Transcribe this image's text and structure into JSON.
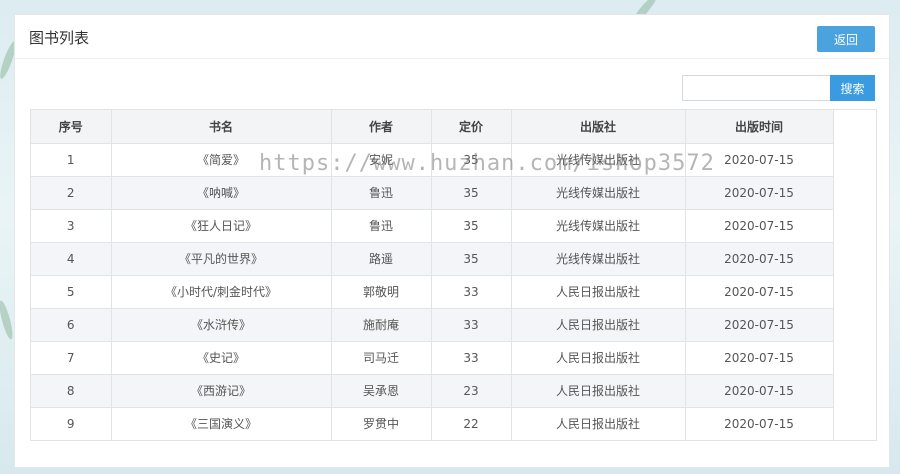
{
  "panel": {
    "title": "图书列表",
    "back_label": "返回"
  },
  "search": {
    "placeholder": "",
    "value": "",
    "button_label": "搜索"
  },
  "table": {
    "headers": [
      "序号",
      "书名",
      "作者",
      "定价",
      "出版社",
      "出版时间"
    ],
    "rows": [
      [
        "1",
        "《简爱》",
        "安妮",
        "35",
        "光线传媒出版社",
        "2020-07-15"
      ],
      [
        "2",
        "《呐喊》",
        "鲁迅",
        "35",
        "光线传媒出版社",
        "2020-07-15"
      ],
      [
        "3",
        "《狂人日记》",
        "鲁迅",
        "35",
        "光线传媒出版社",
        "2020-07-15"
      ],
      [
        "4",
        "《平凡的世界》",
        "路遥",
        "35",
        "光线传媒出版社",
        "2020-07-15"
      ],
      [
        "5",
        "《小时代/刺金时代》",
        "郭敬明",
        "33",
        "人民日报出版社",
        "2020-07-15"
      ],
      [
        "6",
        "《水浒传》",
        "施耐庵",
        "33",
        "人民日报出版社",
        "2020-07-15"
      ],
      [
        "7",
        "《史记》",
        "司马迁",
        "33",
        "人民日报出版社",
        "2020-07-15"
      ],
      [
        "8",
        "《西游记》",
        "吴承恩",
        "23",
        "人民日报出版社",
        "2020-07-15"
      ],
      [
        "9",
        "《三国演义》",
        "罗贯中",
        "22",
        "人民日报出版社",
        "2020-07-15"
      ]
    ]
  },
  "watermark": "https://www.huzhan.com/ishop3572",
  "colors": {
    "accent": "#3a9be0",
    "back_button": "#4aa3df",
    "header_bg": "#f2f4f6",
    "stripe_bg": "#f3f5f8"
  }
}
